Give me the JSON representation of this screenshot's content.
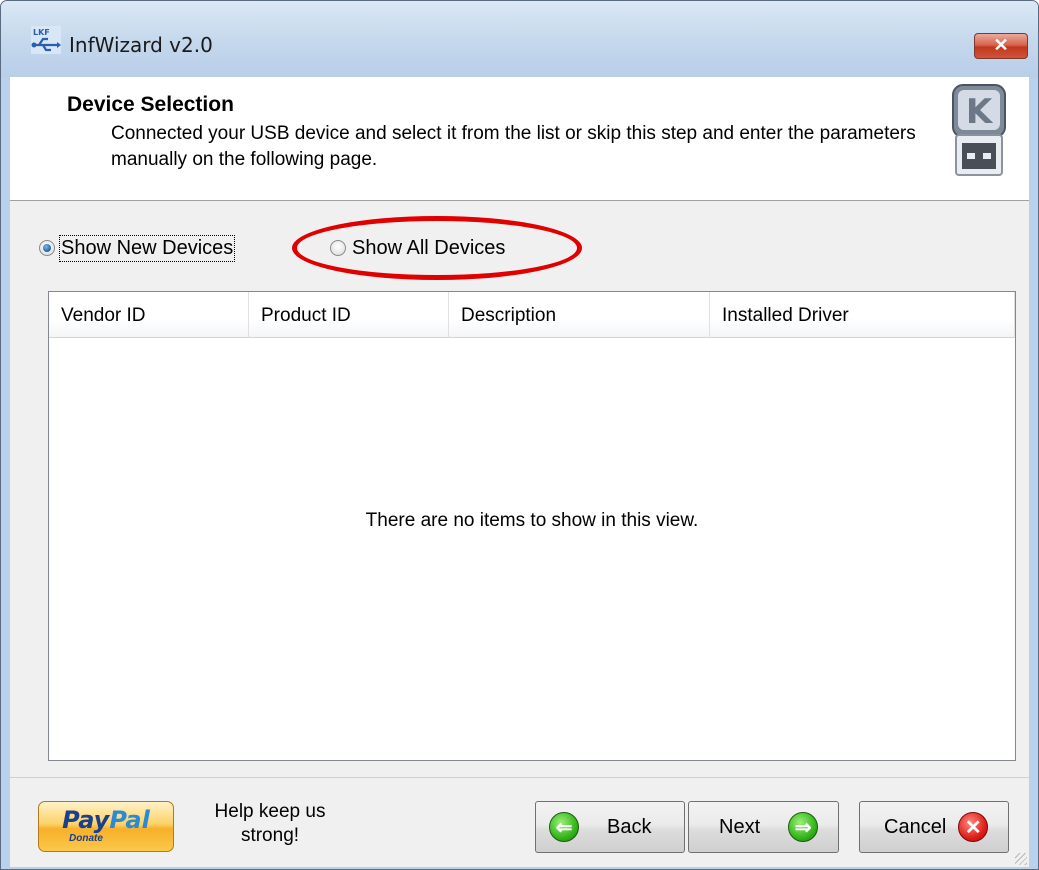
{
  "window": {
    "title": "InfWizard v2.0",
    "close_label": "✕"
  },
  "header": {
    "title": "Device Selection",
    "description": "Connected your USB device and select it from the list or skip this step and enter the parameters manually on the following page."
  },
  "filter": {
    "options": [
      {
        "label": "Show New Devices",
        "checked": true
      },
      {
        "label": "Show All Devices",
        "checked": false
      }
    ],
    "annotation_color": "#e00000"
  },
  "device_list": {
    "columns": [
      "Vendor ID",
      "Product ID",
      "Description",
      "Installed Driver"
    ],
    "rows": [],
    "empty_text": "There are no items to show in this view."
  },
  "footer": {
    "paypal": {
      "brand_pay": "Pay",
      "brand_pal": "Pal",
      "sub": "Donate"
    },
    "help_text": "Help keep us strong!",
    "back_label": "Back",
    "next_label": "Next",
    "cancel_label": "Cancel"
  },
  "icons": {
    "app": "usb-logo-icon",
    "header": "usb-drive-icon",
    "back": "green-arrow-left-icon",
    "next": "green-arrow-right-icon",
    "cancel": "red-x-icon"
  }
}
